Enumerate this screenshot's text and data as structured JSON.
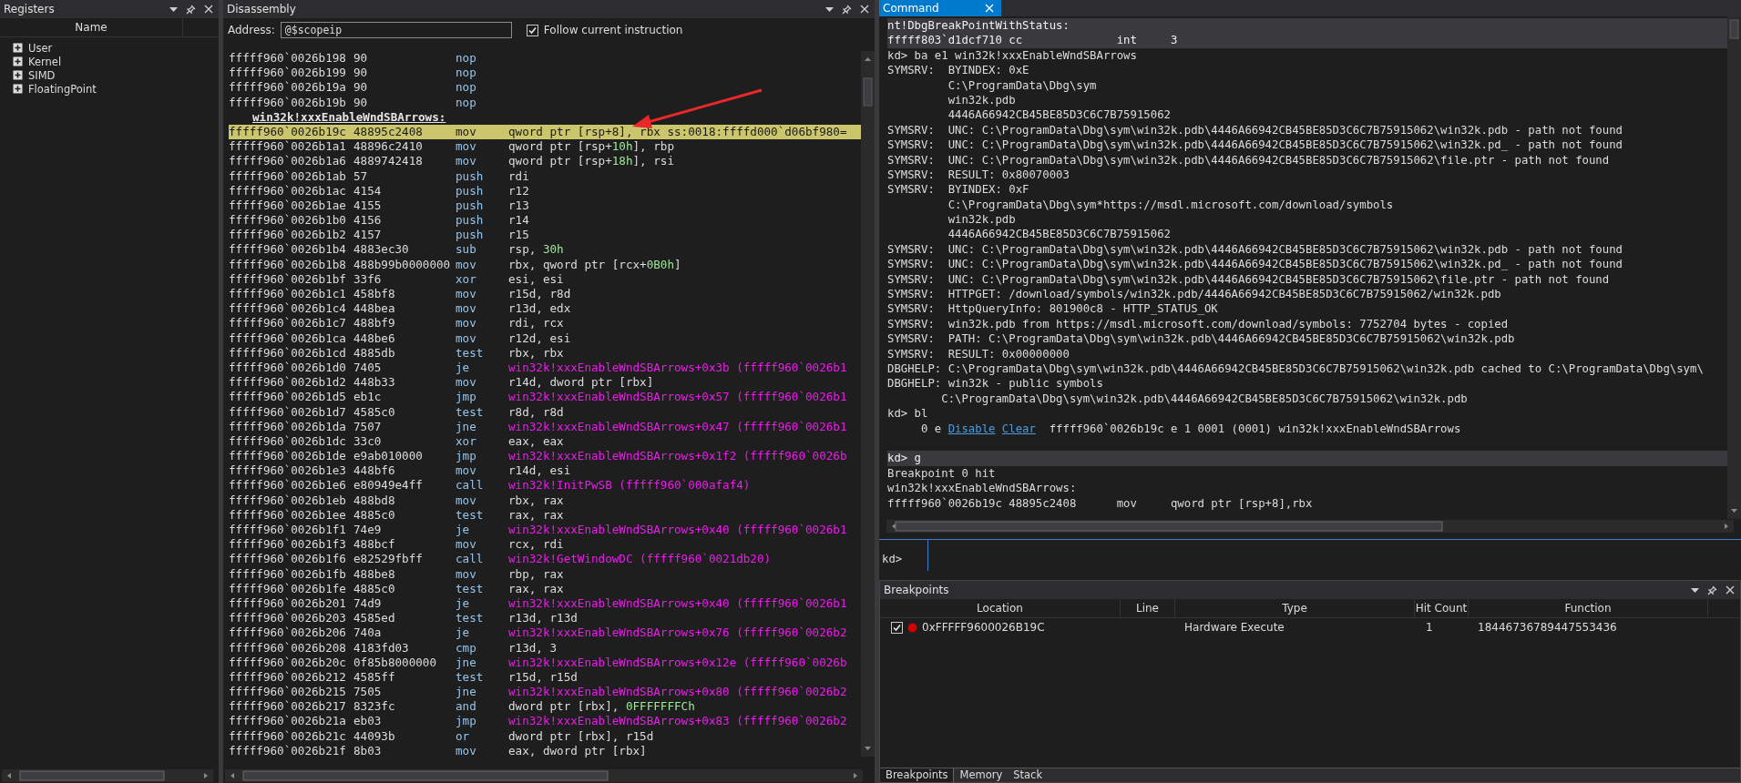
{
  "registers": {
    "title": "Registers",
    "column": "Name",
    "items": [
      {
        "label": "User",
        "expanded": false
      },
      {
        "label": "Kernel",
        "expanded": false
      },
      {
        "label": "SIMD",
        "expanded": false
      },
      {
        "label": "FloatingPoint",
        "expanded": false
      }
    ]
  },
  "disassembly": {
    "title": "Disassembly",
    "address_label": "Address:",
    "address_value": "@$scopeip",
    "follow": {
      "label": "Follow current instruction",
      "checked": true
    },
    "rows": [
      {
        "kind": "instruction",
        "address": "fffff960`0026b198",
        "bytes": "90",
        "mnemonic": "nop",
        "operands": [],
        "current": false
      },
      {
        "kind": "instruction",
        "address": "fffff960`0026b199",
        "bytes": "90",
        "mnemonic": "nop",
        "operands": [],
        "current": false
      },
      {
        "kind": "instruction",
        "address": "fffff960`0026b19a",
        "bytes": "90",
        "mnemonic": "nop",
        "operands": [],
        "current": false
      },
      {
        "kind": "instruction",
        "address": "fffff960`0026b19b",
        "bytes": "90",
        "mnemonic": "nop",
        "operands": [],
        "current": false
      },
      {
        "kind": "label",
        "text": "win32k!xxxEnableWndSBArrows:"
      },
      {
        "kind": "instruction",
        "address": "fffff960`0026b19c",
        "bytes": "48895c2408",
        "mnemonic": "mov",
        "operands": [
          {
            "text": "qword ptr [rsp+8], rbx ss:0018:ffffd000`d06bf980=",
            "kind": "plain"
          }
        ],
        "current": true
      },
      {
        "kind": "instruction",
        "address": "fffff960`0026b1a1",
        "bytes": "48896c2410",
        "mnemonic": "mov",
        "operands": [
          {
            "text": "qword ptr [rsp+",
            "kind": "plain"
          },
          {
            "text": "10h",
            "kind": "number"
          },
          {
            "text": "], rbp",
            "kind": "plain"
          }
        ],
        "current": false
      },
      {
        "kind": "instruction",
        "address": "fffff960`0026b1a6",
        "bytes": "4889742418",
        "mnemonic": "mov",
        "operands": [
          {
            "text": "qword ptr [rsp+",
            "kind": "plain"
          },
          {
            "text": "18h",
            "kind": "number"
          },
          {
            "text": "], rsi",
            "kind": "plain"
          }
        ],
        "current": false
      },
      {
        "kind": "instruction",
        "address": "fffff960`0026b1ab",
        "bytes": "57",
        "mnemonic": "push",
        "operands": [
          {
            "text": "rdi",
            "kind": "plain"
          }
        ],
        "current": false
      },
      {
        "kind": "instruction",
        "address": "fffff960`0026b1ac",
        "bytes": "4154",
        "mnemonic": "push",
        "operands": [
          {
            "text": "r12",
            "kind": "plain"
          }
        ],
        "current": false
      },
      {
        "kind": "instruction",
        "address": "fffff960`0026b1ae",
        "bytes": "4155",
        "mnemonic": "push",
        "operands": [
          {
            "text": "r13",
            "kind": "plain"
          }
        ],
        "current": false
      },
      {
        "kind": "instruction",
        "address": "fffff960`0026b1b0",
        "bytes": "4156",
        "mnemonic": "push",
        "operands": [
          {
            "text": "r14",
            "kind": "plain"
          }
        ],
        "current": false
      },
      {
        "kind": "instruction",
        "address": "fffff960`0026b1b2",
        "bytes": "4157",
        "mnemonic": "push",
        "operands": [
          {
            "text": "r15",
            "kind": "plain"
          }
        ],
        "current": false
      },
      {
        "kind": "instruction",
        "address": "fffff960`0026b1b4",
        "bytes": "4883ec30",
        "mnemonic": "sub",
        "operands": [
          {
            "text": "rsp, ",
            "kind": "plain"
          },
          {
            "text": "30h",
            "kind": "number"
          }
        ],
        "current": false
      },
      {
        "kind": "instruction",
        "address": "fffff960`0026b1b8",
        "bytes": "488b99b0000000",
        "mnemonic": "mov",
        "operands": [
          {
            "text": "rbx, qword ptr [rcx+",
            "kind": "plain"
          },
          {
            "text": "0B0h",
            "kind": "number"
          },
          {
            "text": "]",
            "kind": "plain"
          }
        ],
        "current": false
      },
      {
        "kind": "instruction",
        "address": "fffff960`0026b1bf",
        "bytes": "33f6",
        "mnemonic": "xor",
        "operands": [
          {
            "text": "esi, esi",
            "kind": "plain"
          }
        ],
        "current": false
      },
      {
        "kind": "instruction",
        "address": "fffff960`0026b1c1",
        "bytes": "458bf8",
        "mnemonic": "mov",
        "operands": [
          {
            "text": "r15d, r8d",
            "kind": "plain"
          }
        ],
        "current": false
      },
      {
        "kind": "instruction",
        "address": "fffff960`0026b1c4",
        "bytes": "448bea",
        "mnemonic": "mov",
        "operands": [
          {
            "text": "r13d, edx",
            "kind": "plain"
          }
        ],
        "current": false
      },
      {
        "kind": "instruction",
        "address": "fffff960`0026b1c7",
        "bytes": "488bf9",
        "mnemonic": "mov",
        "operands": [
          {
            "text": "rdi, rcx",
            "kind": "plain"
          }
        ],
        "current": false
      },
      {
        "kind": "instruction",
        "address": "fffff960`0026b1ca",
        "bytes": "448be6",
        "mnemonic": "mov",
        "operands": [
          {
            "text": "r12d, esi",
            "kind": "plain"
          }
        ],
        "current": false
      },
      {
        "kind": "instruction",
        "address": "fffff960`0026b1cd",
        "bytes": "4885db",
        "mnemonic": "test",
        "operands": [
          {
            "text": "rbx, rbx",
            "kind": "plain"
          }
        ],
        "current": false
      },
      {
        "kind": "instruction",
        "address": "fffff960`0026b1d0",
        "bytes": "7405",
        "mnemonic": "je",
        "operands": [
          {
            "text": "win32k!xxxEnableWndSBArrows+0x3b (fffff960`0026b1",
            "kind": "symbol"
          }
        ],
        "current": false
      },
      {
        "kind": "instruction",
        "address": "fffff960`0026b1d2",
        "bytes": "448b33",
        "mnemonic": "mov",
        "operands": [
          {
            "text": "r14d, dword ptr [rbx]",
            "kind": "plain"
          }
        ],
        "current": false
      },
      {
        "kind": "instruction",
        "address": "fffff960`0026b1d5",
        "bytes": "eb1c",
        "mnemonic": "jmp",
        "operands": [
          {
            "text": "win32k!xxxEnableWndSBArrows+0x57 (fffff960`0026b1",
            "kind": "symbol"
          }
        ],
        "current": false
      },
      {
        "kind": "instruction",
        "address": "fffff960`0026b1d7",
        "bytes": "4585c0",
        "mnemonic": "test",
        "operands": [
          {
            "text": "r8d, r8d",
            "kind": "plain"
          }
        ],
        "current": false
      },
      {
        "kind": "instruction",
        "address": "fffff960`0026b1da",
        "bytes": "7507",
        "mnemonic": "jne",
        "operands": [
          {
            "text": "win32k!xxxEnableWndSBArrows+0x47 (fffff960`0026b1",
            "kind": "symbol"
          }
        ],
        "current": false
      },
      {
        "kind": "instruction",
        "address": "fffff960`0026b1dc",
        "bytes": "33c0",
        "mnemonic": "xor",
        "operands": [
          {
            "text": "eax, eax",
            "kind": "plain"
          }
        ],
        "current": false
      },
      {
        "kind": "instruction",
        "address": "fffff960`0026b1de",
        "bytes": "e9ab010000",
        "mnemonic": "jmp",
        "operands": [
          {
            "text": "win32k!xxxEnableWndSBArrows+0x1f2 (fffff960`0026b",
            "kind": "symbol"
          }
        ],
        "current": false
      },
      {
        "kind": "instruction",
        "address": "fffff960`0026b1e3",
        "bytes": "448bf6",
        "mnemonic": "mov",
        "operands": [
          {
            "text": "r14d, esi",
            "kind": "plain"
          }
        ],
        "current": false
      },
      {
        "kind": "instruction",
        "address": "fffff960`0026b1e6",
        "bytes": "e80949e4ff",
        "mnemonic": "call",
        "operands": [
          {
            "text": "win32k!InitPwSB (fffff960`000afaf4)",
            "kind": "symbol"
          }
        ],
        "current": false
      },
      {
        "kind": "instruction",
        "address": "fffff960`0026b1eb",
        "bytes": "488bd8",
        "mnemonic": "mov",
        "operands": [
          {
            "text": "rbx, rax",
            "kind": "plain"
          }
        ],
        "current": false
      },
      {
        "kind": "instruction",
        "address": "fffff960`0026b1ee",
        "bytes": "4885c0",
        "mnemonic": "test",
        "operands": [
          {
            "text": "rax, rax",
            "kind": "plain"
          }
        ],
        "current": false
      },
      {
        "kind": "instruction",
        "address": "fffff960`0026b1f1",
        "bytes": "74e9",
        "mnemonic": "je",
        "operands": [
          {
            "text": "win32k!xxxEnableWndSBArrows+0x40 (fffff960`0026b1",
            "kind": "symbol"
          }
        ],
        "current": false
      },
      {
        "kind": "instruction",
        "address": "fffff960`0026b1f3",
        "bytes": "488bcf",
        "mnemonic": "mov",
        "operands": [
          {
            "text": "rcx, rdi",
            "kind": "plain"
          }
        ],
        "current": false
      },
      {
        "kind": "instruction",
        "address": "fffff960`0026b1f6",
        "bytes": "e82529fbff",
        "mnemonic": "call",
        "operands": [
          {
            "text": "win32k!GetWindowDC (fffff960`0021db20)",
            "kind": "symbol"
          }
        ],
        "current": false
      },
      {
        "kind": "instruction",
        "address": "fffff960`0026b1fb",
        "bytes": "488be8",
        "mnemonic": "mov",
        "operands": [
          {
            "text": "rbp, rax",
            "kind": "plain"
          }
        ],
        "current": false
      },
      {
        "kind": "instruction",
        "address": "fffff960`0026b1fe",
        "bytes": "4885c0",
        "mnemonic": "test",
        "operands": [
          {
            "text": "rax, rax",
            "kind": "plain"
          }
        ],
        "current": false
      },
      {
        "kind": "instruction",
        "address": "fffff960`0026b201",
        "bytes": "74d9",
        "mnemonic": "je",
        "operands": [
          {
            "text": "win32k!xxxEnableWndSBArrows+0x40 (fffff960`0026b1",
            "kind": "symbol"
          }
        ],
        "current": false
      },
      {
        "kind": "instruction",
        "address": "fffff960`0026b203",
        "bytes": "4585ed",
        "mnemonic": "test",
        "operands": [
          {
            "text": "r13d, r13d",
            "kind": "plain"
          }
        ],
        "current": false
      },
      {
        "kind": "instruction",
        "address": "fffff960`0026b206",
        "bytes": "740a",
        "mnemonic": "je",
        "operands": [
          {
            "text": "win32k!xxxEnableWndSBArrows+0x76 (fffff960`0026b2",
            "kind": "symbol"
          }
        ],
        "current": false
      },
      {
        "kind": "instruction",
        "address": "fffff960`0026b208",
        "bytes": "4183fd03",
        "mnemonic": "cmp",
        "operands": [
          {
            "text": "r13d, 3",
            "kind": "plain"
          }
        ],
        "current": false
      },
      {
        "kind": "instruction",
        "address": "fffff960`0026b20c",
        "bytes": "0f85b8000000",
        "mnemonic": "jne",
        "operands": [
          {
            "text": "win32k!xxxEnableWndSBArrows+0x12e (fffff960`0026b",
            "kind": "symbol"
          }
        ],
        "current": false
      },
      {
        "kind": "instruction",
        "address": "fffff960`0026b212",
        "bytes": "4585ff",
        "mnemonic": "test",
        "operands": [
          {
            "text": "r15d, r15d",
            "kind": "plain"
          }
        ],
        "current": false
      },
      {
        "kind": "instruction",
        "address": "fffff960`0026b215",
        "bytes": "7505",
        "mnemonic": "jne",
        "operands": [
          {
            "text": "win32k!xxxEnableWndSBArrows+0x80 (fffff960`0026b2",
            "kind": "symbol"
          }
        ],
        "current": false
      },
      {
        "kind": "instruction",
        "address": "fffff960`0026b217",
        "bytes": "8323fc",
        "mnemonic": "and",
        "operands": [
          {
            "text": "dword ptr [rbx], ",
            "kind": "plain"
          },
          {
            "text": "0FFFFFFFCh",
            "kind": "number"
          }
        ],
        "current": false
      },
      {
        "kind": "instruction",
        "address": "fffff960`0026b21a",
        "bytes": "eb03",
        "mnemonic": "jmp",
        "operands": [
          {
            "text": "win32k!xxxEnableWndSBArrows+0x83 (fffff960`0026b2",
            "kind": "symbol"
          }
        ],
        "current": false
      },
      {
        "kind": "instruction",
        "address": "fffff960`0026b21c",
        "bytes": "44093b",
        "mnemonic": "or",
        "operands": [
          {
            "text": "dword ptr [rbx], r15d",
            "kind": "plain"
          }
        ],
        "current": false
      },
      {
        "kind": "instruction",
        "address": "fffff960`0026b21f",
        "bytes": "8b03",
        "mnemonic": "mov",
        "operands": [
          {
            "text": "eax, dword ptr [rbx]",
            "kind": "plain"
          }
        ],
        "current": false
      }
    ]
  },
  "command": {
    "title": "Command",
    "lines": [
      {
        "text": "nt!DbgBreakPointWithStatus:",
        "shaded": true
      },
      {
        "text": "fffff803`d1dcf710 cc              int     3",
        "shaded": true
      },
      {
        "text": "kd> ba e1 win32k!xxxEnableWndSBArrows",
        "shaded": false
      },
      {
        "text": "SYMSRV:  BYINDEX: 0xE",
        "shaded": false
      },
      {
        "text": "         C:\\ProgramData\\Dbg\\sym",
        "shaded": false
      },
      {
        "text": "         win32k.pdb",
        "shaded": false
      },
      {
        "text": "         4446A66942CB45BE85D3C6C7B75915062",
        "shaded": false
      },
      {
        "text": "SYMSRV:  UNC: C:\\ProgramData\\Dbg\\sym\\win32k.pdb\\4446A66942CB45BE85D3C6C7B75915062\\win32k.pdb - path not found",
        "shaded": false
      },
      {
        "text": "SYMSRV:  UNC: C:\\ProgramData\\Dbg\\sym\\win32k.pdb\\4446A66942CB45BE85D3C6C7B75915062\\win32k.pd_ - path not found",
        "shaded": false
      },
      {
        "text": "SYMSRV:  UNC: C:\\ProgramData\\Dbg\\sym\\win32k.pdb\\4446A66942CB45BE85D3C6C7B75915062\\file.ptr - path not found",
        "shaded": false
      },
      {
        "text": "SYMSRV:  RESULT: 0x80070003",
        "shaded": false
      },
      {
        "text": "SYMSRV:  BYINDEX: 0xF",
        "shaded": false
      },
      {
        "text": "         C:\\ProgramData\\Dbg\\sym*https://msdl.microsoft.com/download/symbols",
        "shaded": false
      },
      {
        "text": "         win32k.pdb",
        "shaded": false
      },
      {
        "text": "         4446A66942CB45BE85D3C6C7B75915062",
        "shaded": false
      },
      {
        "text": "SYMSRV:  UNC: C:\\ProgramData\\Dbg\\sym\\win32k.pdb\\4446A66942CB45BE85D3C6C7B75915062\\win32k.pdb - path not found",
        "shaded": false
      },
      {
        "text": "SYMSRV:  UNC: C:\\ProgramData\\Dbg\\sym\\win32k.pdb\\4446A66942CB45BE85D3C6C7B75915062\\win32k.pd_ - path not found",
        "shaded": false
      },
      {
        "text": "SYMSRV:  UNC: C:\\ProgramData\\Dbg\\sym\\win32k.pdb\\4446A66942CB45BE85D3C6C7B75915062\\file.ptr - path not found",
        "shaded": false
      },
      {
        "text": "SYMSRV:  HTTPGET: /download/symbols/win32k.pdb/4446A66942CB45BE85D3C6C7B75915062/win32k.pdb",
        "shaded": false
      },
      {
        "text": "SYMSRV:  HttpQueryInfo: 801900c8 - HTTP_STATUS_OK",
        "shaded": false
      },
      {
        "text": "SYMSRV:  win32k.pdb from https://msdl.microsoft.com/download/symbols: 7752704 bytes - copied",
        "shaded": false
      },
      {
        "text": "SYMSRV:  PATH: C:\\ProgramData\\Dbg\\sym\\win32k.pdb\\4446A66942CB45BE85D3C6C7B75915062\\win32k.pdb",
        "shaded": false
      },
      {
        "text": "SYMSRV:  RESULT: 0x00000000",
        "shaded": false
      },
      {
        "text": "DBGHELP: C:\\ProgramData\\Dbg\\sym\\win32k.pdb\\4446A66942CB45BE85D3C6C7B75915062\\win32k.pdb cached to C:\\ProgramData\\Dbg\\sym\\",
        "shaded": false
      },
      {
        "text": "DBGHELP: win32k - public symbols",
        "shaded": false
      },
      {
        "text": "        C:\\ProgramData\\Dbg\\sym\\win32k.pdb\\4446A66942CB45BE85D3C6C7B75915062\\win32k.pdb",
        "shaded": false
      },
      {
        "text": "kd> bl",
        "shaded": false
      },
      {
        "segments": [
          {
            "text": "     0 e ",
            "kind": "plain"
          },
          {
            "text": "Disable",
            "kind": "link"
          },
          {
            "text": "Clear",
            "kind": "link"
          },
          {
            "text": " fffff960`0026b19c e 1 0001 (0001) win32k!xxxEnableWndSBArrows",
            "kind": "plain"
          }
        ],
        "shaded": false,
        "gap_after": true
      },
      {
        "text": "kd> g",
        "shaded": true
      },
      {
        "text": "Breakpoint 0 hit",
        "shaded": false
      },
      {
        "text": "win32k!xxxEnableWndSBArrows:",
        "shaded": false
      },
      {
        "text": "fffff960`0026b19c 48895c2408      mov     qword ptr [rsp+8],rbx",
        "shaded": false
      }
    ],
    "prompt": "kd>"
  },
  "breakpoints": {
    "title": "Breakpoints",
    "columns": [
      "Location",
      "Line",
      "Type",
      "Hit Count",
      "Function"
    ],
    "rows": [
      {
        "checked": true,
        "enabled": true,
        "location": "0xFFFFF9600026B19C",
        "type": "Hardware Execute",
        "hit_count": "1",
        "function": "18446736789447553436"
      }
    ],
    "tabs": [
      {
        "label": "Breakpoints",
        "selected": true
      },
      {
        "label": "Memory",
        "selected": false
      },
      {
        "label": "Stack",
        "selected": false
      }
    ]
  }
}
